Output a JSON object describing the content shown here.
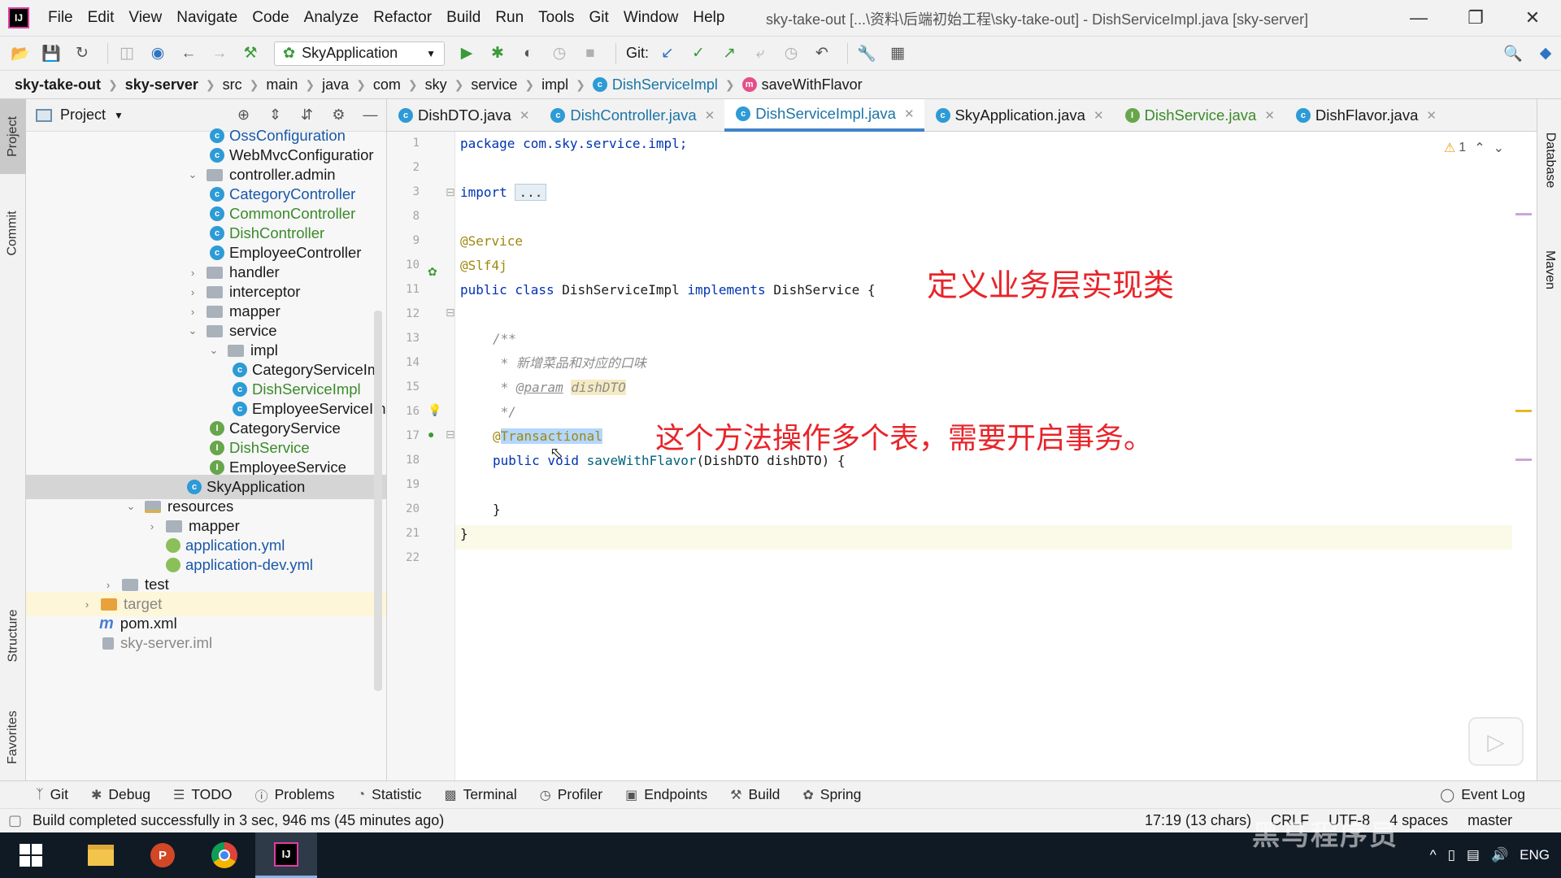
{
  "window": {
    "title": "sky-take-out [...\\资料\\后端初始工程\\sky-take-out] - DishServiceImpl.java [sky-server]",
    "menu": [
      "File",
      "Edit",
      "View",
      "Navigate",
      "Code",
      "Analyze",
      "Refactor",
      "Build",
      "Run",
      "Tools",
      "Git",
      "Window",
      "Help"
    ],
    "controls": {
      "minimize": "—",
      "restore": "❐",
      "close": "✕"
    }
  },
  "toolbar": {
    "run_config": "SkyApplication",
    "git_label": "Git:"
  },
  "breadcrumb": {
    "items": [
      "sky-take-out",
      "sky-server",
      "src",
      "main",
      "java",
      "com",
      "sky",
      "service",
      "impl",
      "DishServiceImpl",
      "saveWithFlavor"
    ]
  },
  "left_stripe": {
    "tabs": [
      "Project",
      "Commit",
      "Structure",
      "Favorites"
    ]
  },
  "project": {
    "title": "Project",
    "tree": [
      {
        "label": "OssConfiguration",
        "kind": "class",
        "color": "normal"
      },
      {
        "label": "WebMvcConfiguratior",
        "kind": "class",
        "color": "normal"
      },
      {
        "label": "controller.admin",
        "kind": "package",
        "color": "normal",
        "expanded": true
      },
      {
        "label": "CategoryController",
        "kind": "class",
        "color": "blue"
      },
      {
        "label": "CommonController",
        "kind": "class",
        "color": "green"
      },
      {
        "label": "DishController",
        "kind": "class",
        "color": "green"
      },
      {
        "label": "EmployeeController",
        "kind": "class",
        "color": "normal"
      },
      {
        "label": "handler",
        "kind": "package",
        "color": "normal",
        "expanded": false
      },
      {
        "label": "interceptor",
        "kind": "package",
        "color": "normal",
        "expanded": false
      },
      {
        "label": "mapper",
        "kind": "package",
        "color": "normal",
        "expanded": false
      },
      {
        "label": "service",
        "kind": "package",
        "color": "normal",
        "expanded": true
      },
      {
        "label": "impl",
        "kind": "package",
        "color": "normal",
        "expanded": true
      },
      {
        "label": "CategoryServiceIm",
        "kind": "class",
        "color": "normal"
      },
      {
        "label": "DishServiceImpl",
        "kind": "class",
        "color": "green"
      },
      {
        "label": "EmployeeServiceIm",
        "kind": "class",
        "color": "normal"
      },
      {
        "label": "CategoryService",
        "kind": "interface",
        "color": "normal"
      },
      {
        "label": "DishService",
        "kind": "interface",
        "color": "green"
      },
      {
        "label": "EmployeeService",
        "kind": "interface",
        "color": "normal"
      },
      {
        "label": "SkyApplication",
        "kind": "app",
        "color": "normal",
        "selected": true
      },
      {
        "label": "resources",
        "kind": "resources",
        "color": "normal",
        "expanded": true
      },
      {
        "label": "mapper",
        "kind": "folder",
        "color": "normal",
        "expanded": false
      },
      {
        "label": "application.yml",
        "kind": "yml",
        "color": "blue"
      },
      {
        "label": "application-dev.yml",
        "kind": "yml",
        "color": "blue"
      },
      {
        "label": "test",
        "kind": "folder",
        "color": "normal",
        "expanded": false
      },
      {
        "label": "target",
        "kind": "target",
        "color": "gray",
        "expanded": false
      },
      {
        "label": "pom.xml",
        "kind": "maven",
        "color": "normal"
      },
      {
        "label": "sky-server.iml",
        "kind": "iml",
        "color": "gray"
      }
    ]
  },
  "editor": {
    "tabs": [
      {
        "label": "DishDTO.java",
        "state": "normal"
      },
      {
        "label": "DishController.java",
        "state": "changed"
      },
      {
        "label": "DishServiceImpl.java",
        "state": "active"
      },
      {
        "label": "SkyApplication.java",
        "state": "normal"
      },
      {
        "label": "DishService.java",
        "state": "modified"
      },
      {
        "label": "DishFlavor.java",
        "state": "normal"
      }
    ],
    "line_numbers": [
      "1",
      "2",
      "3",
      "8",
      "9",
      "10",
      "11",
      "12",
      "13",
      "14",
      "15",
      "16",
      "17",
      "18",
      "19",
      "20",
      "21",
      "22"
    ],
    "code": {
      "l1": "package com.sky.service.impl;",
      "l3_kw": "import",
      "l3_fold": "...",
      "l9": "@Service",
      "l10": "@Slf4j",
      "l11_kw": "public class",
      "l11_name": " DishServiceImpl ",
      "l11_kw2": "implements",
      "l11_rest": " DishService {",
      "l13": "/**",
      "l14": " * 新增菜品和对应的口味",
      "l15_star": " * ",
      "l15_tag": "@param",
      "l15_param": "dishDTO",
      "l16": " */",
      "l17_at": "@",
      "l17_ann": "Transactional",
      "l18_kw": "public void",
      "l18_method": " saveWithFlavor",
      "l18_rest": "(DishDTO dishDTO) {",
      "l20": "}",
      "l21": "}"
    },
    "annotations": {
      "a1": "定义业务层实现类",
      "a2": "这个方法操作多个表，需要开启事务。"
    },
    "inspection": {
      "warnings": "1"
    }
  },
  "right_stripe": {
    "tabs": [
      "Database",
      "Maven"
    ]
  },
  "tool_windows": {
    "items": [
      "Git",
      "Debug",
      "TODO",
      "Problems",
      "Statistic",
      "Terminal",
      "Profiler",
      "Endpoints",
      "Build",
      "Spring"
    ],
    "event_log": "Event Log"
  },
  "status": {
    "message": "Build completed successfully in 3 sec, 946 ms (45 minutes ago)",
    "position": "17:19 (13 chars)",
    "line_sep": "CRLF",
    "encoding": "UTF-8",
    "indent": "4 spaces",
    "branch": "master"
  },
  "taskbar": {
    "tray": [
      "^",
      "ENG"
    ]
  },
  "watermark": "黑马程序员"
}
